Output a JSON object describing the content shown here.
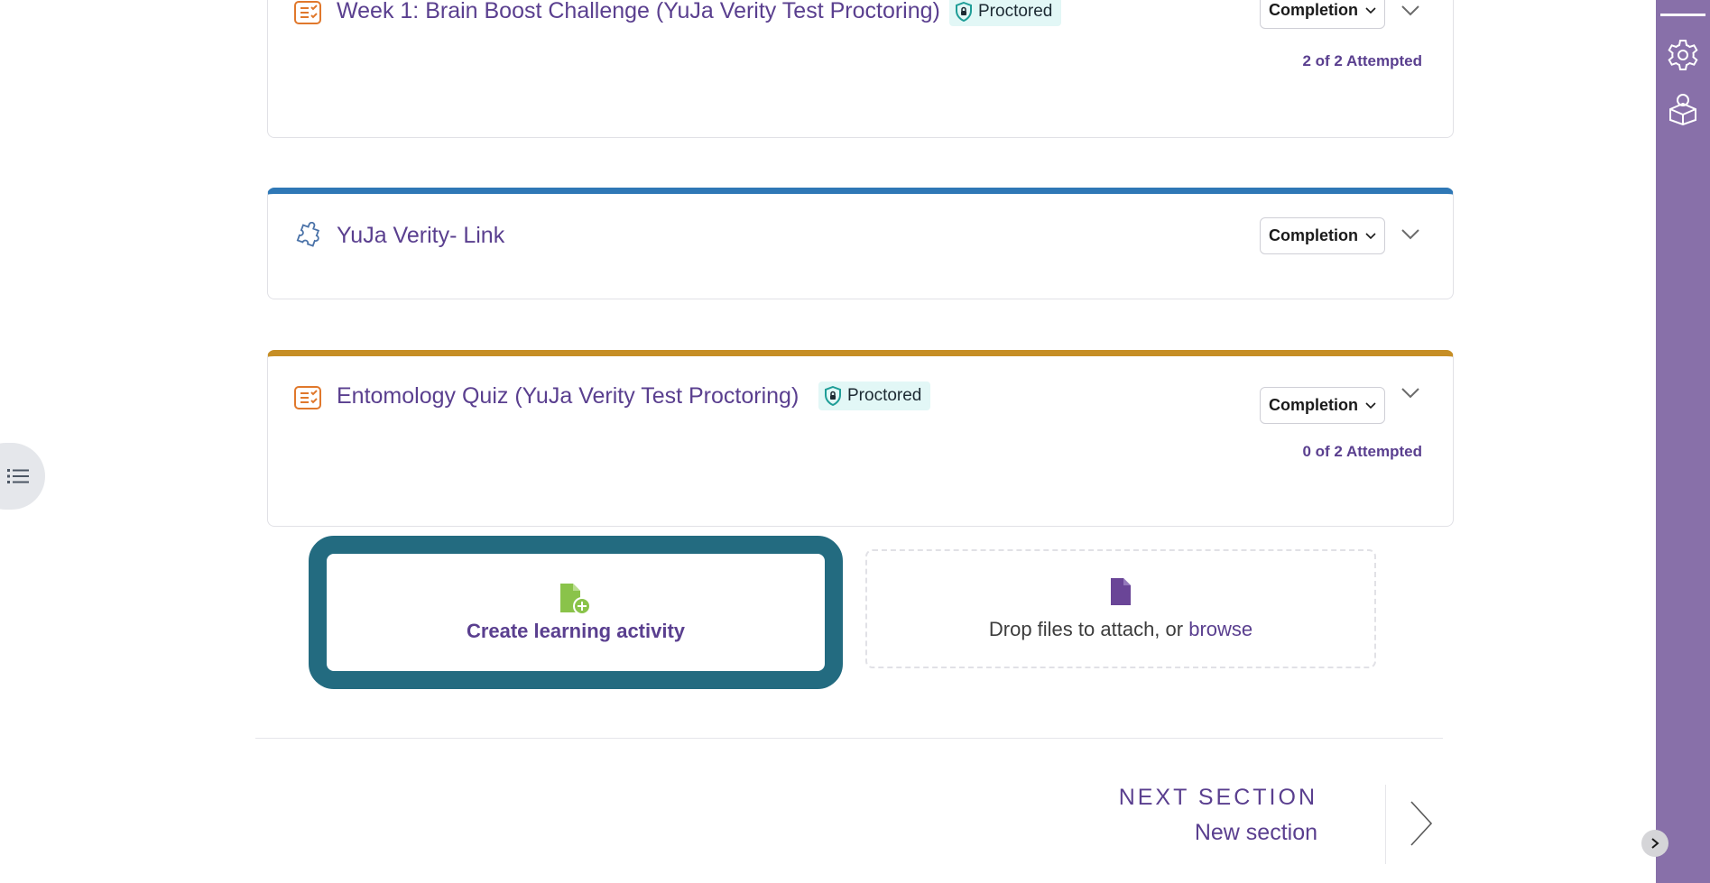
{
  "activities": [
    {
      "title": "Week 1: Brain Boost Challenge (YuJa Verity Test Proctoring)",
      "icon": "quiz-icon",
      "badge": "Proctored",
      "completion": "Completion",
      "attempted": "2 of 2 Attempted"
    },
    {
      "title": "YuJa Verity- Link",
      "icon": "puzzle-icon",
      "completion": "Completion"
    },
    {
      "title": "Entomology Quiz (YuJa Verity Test Proctoring)",
      "icon": "quiz-icon",
      "badge": "Proctored",
      "completion": "Completion",
      "attempted": "0 of 2 Attempted"
    }
  ],
  "create": {
    "label": "Create learning activity"
  },
  "drop": {
    "text": "Drop files to attach, or ",
    "browse": "browse"
  },
  "next_section": {
    "caption": "NEXT SECTION",
    "name": "New section"
  },
  "colors": {
    "accent_purple": "#5a3f8f",
    "sidebar": "#8870a9",
    "blue_bar": "#2f78b6",
    "gold_bar": "#c68e25",
    "focus_ring": "#236b80",
    "quiz_icon": "#e0782c",
    "file_green": "#8ac34a"
  }
}
